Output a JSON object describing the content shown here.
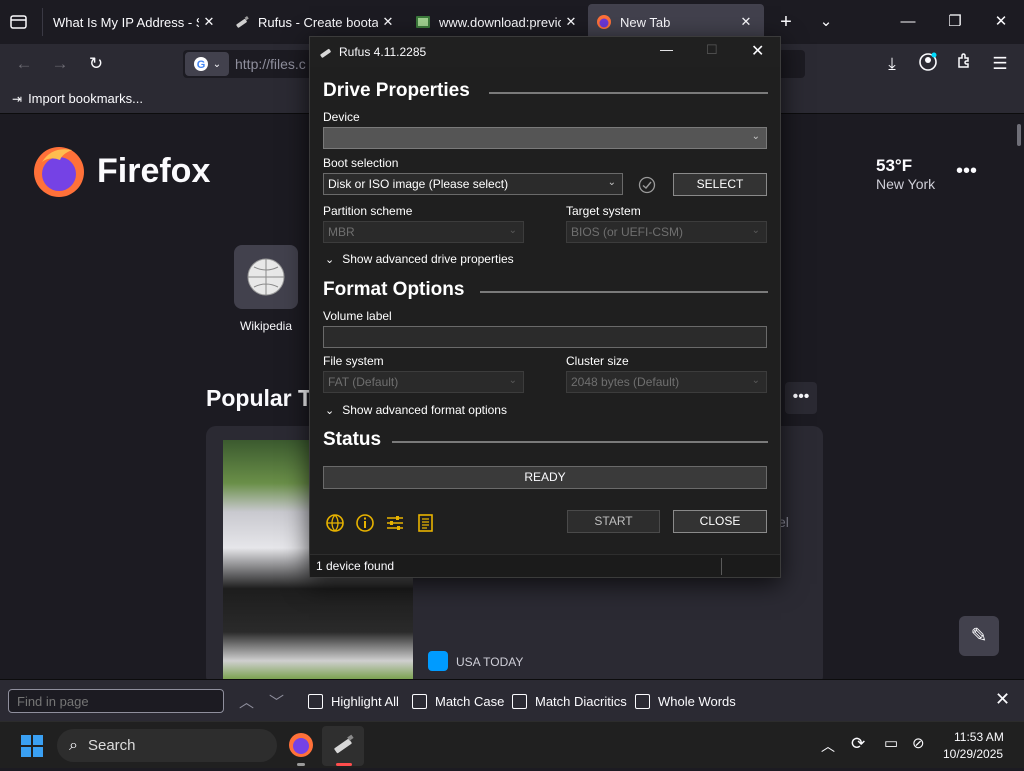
{
  "tabs": [
    {
      "title": "What Is My IP Address - See Your Public Address",
      "active": false
    },
    {
      "title": "Rufus - Create bootable USB drives the easy way",
      "active": false
    },
    {
      "title": "www.download:previous versions",
      "active": false
    },
    {
      "title": "New Tab",
      "active": true
    }
  ],
  "navbar": {
    "url": "http://files.c"
  },
  "bookmarks": {
    "import_label": "Import bookmarks..."
  },
  "newtab": {
    "brand": "Firefox",
    "weather_temp": "53°F",
    "weather_city": "New York",
    "shortcut_label": "Wikipedia",
    "popular_heading": "Popular T",
    "card_text": "el",
    "card_source": "USA TODAY"
  },
  "findbar": {
    "placeholder": "Find in page",
    "highlight_all": "Highlight All",
    "match_case": "Match Case",
    "match_diacritics": "Match Diacritics",
    "whole_words": "Whole Words"
  },
  "taskbar": {
    "search_placeholder": "Search",
    "time": "11:53 AM",
    "date": "10/29/2025"
  },
  "rufus": {
    "title": "Rufus 4.11.2285",
    "drive_properties": "Drive Properties",
    "device_label": "Device",
    "device_value": "",
    "boot_selection_label": "Boot selection",
    "boot_selection_value": "Disk or ISO image (Please select)",
    "select_button": "SELECT",
    "partition_scheme_label": "Partition scheme",
    "partition_scheme_value": "MBR",
    "target_system_label": "Target system",
    "target_system_value": "BIOS (or UEFI-CSM)",
    "advanced_drive": "Show advanced drive properties",
    "format_options": "Format Options",
    "volume_label_label": "Volume label",
    "volume_label_value": "",
    "file_system_label": "File system",
    "file_system_value": "FAT (Default)",
    "cluster_size_label": "Cluster size",
    "cluster_size_value": "2048 bytes (Default)",
    "advanced_format": "Show advanced format options",
    "status_heading": "Status",
    "status_text": "READY",
    "start_button": "START",
    "close_button": "CLOSE",
    "statusbar_text": "1 device found"
  },
  "colors": {
    "firefox_dark": "#1c1b22",
    "toolbar": "#2b2a33",
    "rufus_bg": "#1f1f1f",
    "rufus_icons": "#e8b300"
  }
}
